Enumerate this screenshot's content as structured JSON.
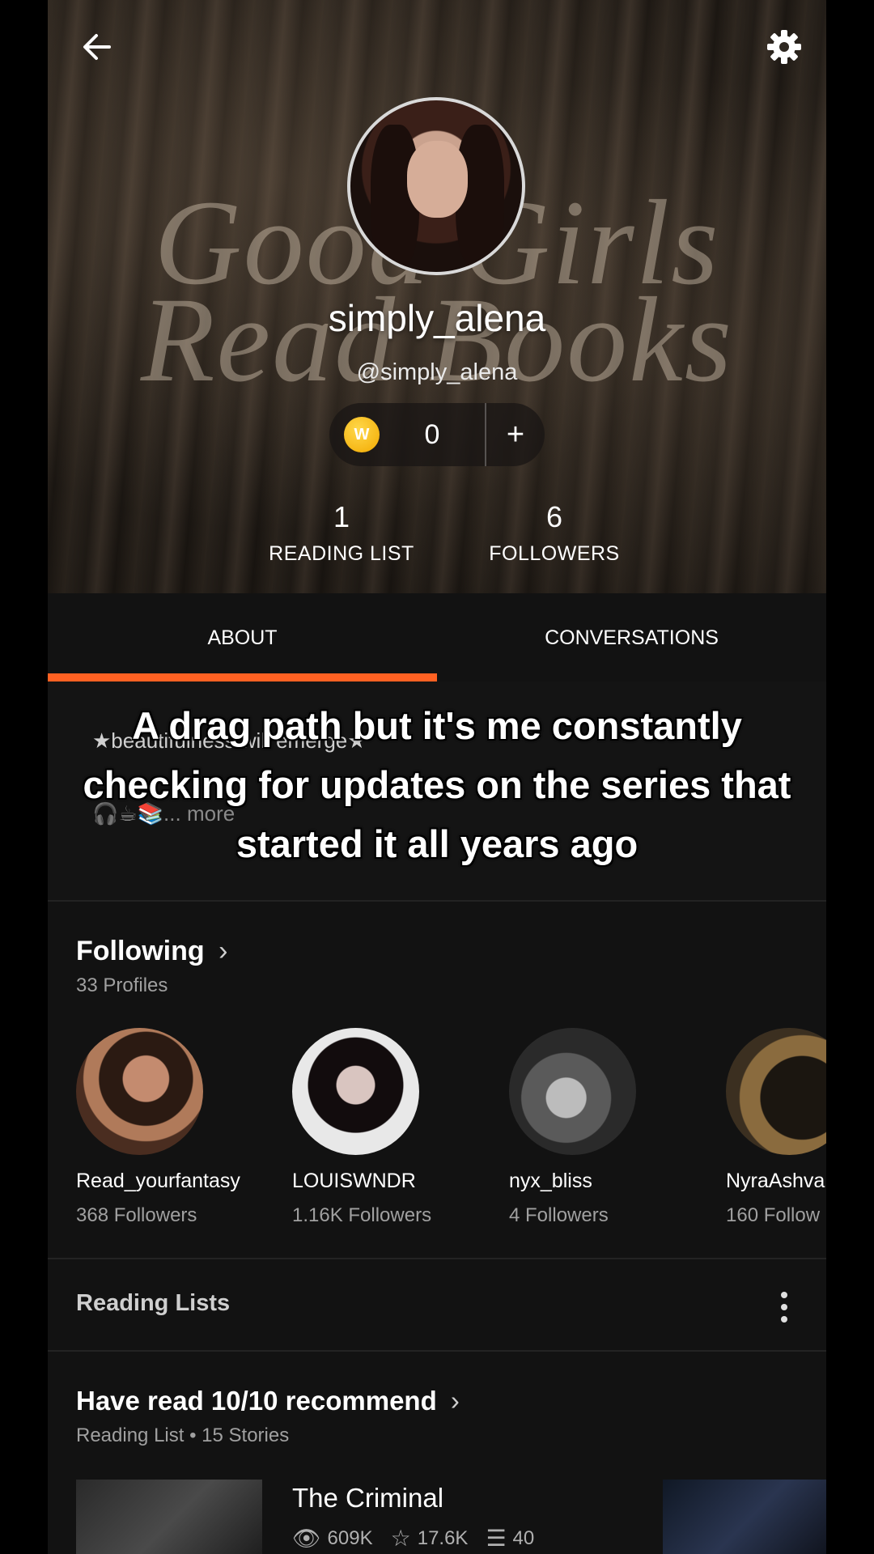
{
  "header": {
    "watermark_line1": "Good Girls",
    "watermark_line2": "Read Books",
    "display_name": "simply_alena",
    "handle": "@simply_alena",
    "coins": {
      "count": "0",
      "add_label": "+"
    },
    "stats": [
      {
        "number": "1",
        "label": "READING LIST"
      },
      {
        "number": "6",
        "label": "FOLLOWERS"
      }
    ],
    "icons": {
      "back": "arrow-left-icon",
      "settings": "gear-icon",
      "coin": "wattpad-coin-icon"
    }
  },
  "tabs": [
    {
      "label": "ABOUT",
      "selected": true
    },
    {
      "label": "CONVERSATIONS",
      "selected": false
    }
  ],
  "accent_color": "#ff6122",
  "about": {
    "bio_line1": "★beautifulness will emerge★",
    "bio_line2": "🎧☕📚... more"
  },
  "caption": {
    "line1": "A drag path but it's me constantly",
    "line2": "checking for updates on the series that",
    "line3": "started it all years ago"
  },
  "following": {
    "title": "Following",
    "subtitle": "33 Profiles",
    "profiles": [
      {
        "name": "Read_yourfantasy",
        "followers": "368 Followers"
      },
      {
        "name": "LOUISWNDR",
        "followers": "1.16K Followers"
      },
      {
        "name": "nyx_bliss",
        "followers": "4 Followers"
      },
      {
        "name": "NyraAshva",
        "followers": "160 Follow"
      }
    ]
  },
  "reading_lists": {
    "header": "Reading Lists",
    "list_title": "Have read 10/10 recommend",
    "list_sub": "Reading List • 15 Stories",
    "book": {
      "title": "The Criminal",
      "reads": "609K",
      "votes": "17.6K",
      "parts": "40"
    }
  }
}
